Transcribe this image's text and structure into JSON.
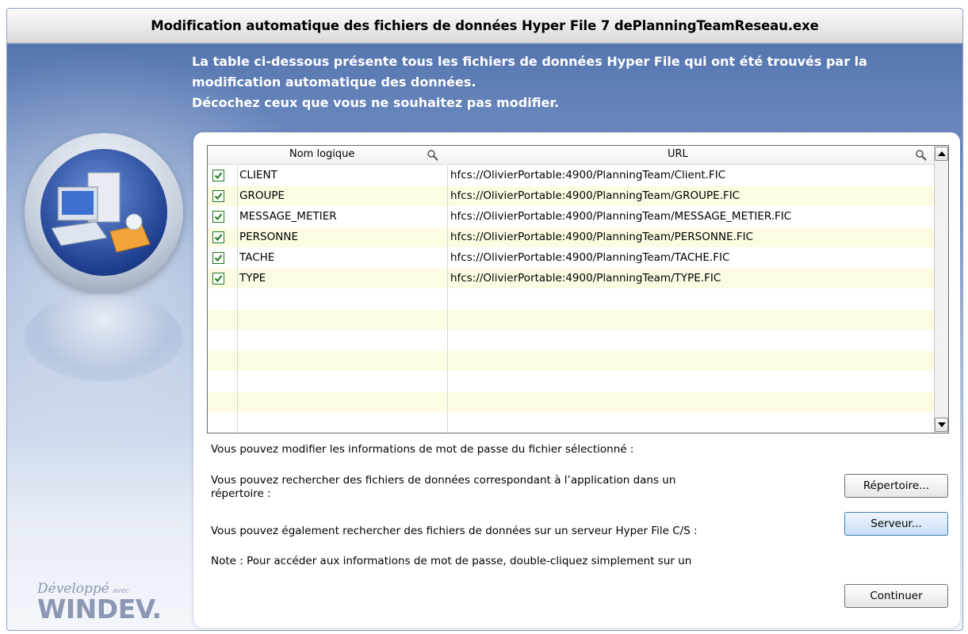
{
  "window": {
    "title": "Modification automatique des fichiers de données Hyper File 7 dePlanningTeamReseau.exe"
  },
  "intro": {
    "line1": "La table ci-dessous présente tous les fichiers de données Hyper File qui ont été trouvés par la",
    "line2": "modification automatique des données.",
    "line3": "Décochez ceux que vous ne souhaitez pas modifier."
  },
  "table": {
    "columns": {
      "name": "Nom logique",
      "url": "URL"
    },
    "rows": [
      {
        "checked": true,
        "name": "CLIENT",
        "url": "hfcs://OlivierPortable:4900/PlanningTeam/Client.FIC"
      },
      {
        "checked": true,
        "name": "GROUPE",
        "url": "hfcs://OlivierPortable:4900/PlanningTeam/GROUPE.FIC"
      },
      {
        "checked": true,
        "name": "MESSAGE_METIER",
        "url": "hfcs://OlivierPortable:4900/PlanningTeam/MESSAGE_METIER.FIC"
      },
      {
        "checked": true,
        "name": "PERSONNE",
        "url": "hfcs://OlivierPortable:4900/PlanningTeam/PERSONNE.FIC"
      },
      {
        "checked": true,
        "name": "TACHE",
        "url": "hfcs://OlivierPortable:4900/PlanningTeam/TACHE.FIC"
      },
      {
        "checked": true,
        "name": "TYPE",
        "url": "hfcs://OlivierPortable:4900/PlanningTeam/TYPE.FIC"
      }
    ]
  },
  "info": {
    "password": "Vous pouvez modifier les informations de mot de passe du fichier sélectionné :",
    "directory_line1": "Vous pouvez rechercher des fichiers de données correspondant à l’application dans un",
    "directory_line2": "répertoire :",
    "server": "Vous pouvez également rechercher des fichiers de données sur un serveur Hyper File C/S :",
    "note": "Note : Pour accéder aux informations de mot de passe, double-cliquez simplement sur un"
  },
  "buttons": {
    "directory": "Répertoire...",
    "server": "Serveur...",
    "continue": "Continuer"
  },
  "brand": {
    "developed": "Développé",
    "with": "avec",
    "product": "WINDEV."
  },
  "colors": {
    "check_green": "#1e7a1e",
    "row_alt": "#fdfbe2",
    "intro_text": "#ffffff"
  }
}
